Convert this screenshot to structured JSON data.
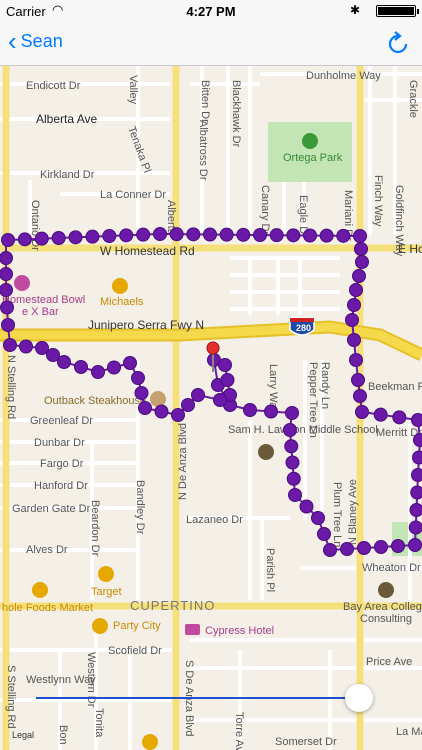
{
  "status_bar": {
    "carrier": "Carrier",
    "time": "4:27 PM"
  },
  "nav": {
    "back_label": "Sean"
  },
  "colors": {
    "accent": "#007aff",
    "route": "#6a1aa6",
    "pin": "#e53030"
  },
  "icons": {
    "back": "chevron-left-icon",
    "refresh": "refresh-icon",
    "wifi": "wifi-icon",
    "bluetooth": "bluetooth-icon"
  },
  "map": {
    "streets": [
      "Endicott Dr",
      "Alberta Ave",
      "Kirkland Dr",
      "La Conner Dr",
      "W Homestead Rd",
      "E Ho",
      "Junipero Serra Fwy N",
      "280",
      "Dunholme Way",
      "Ortega Park",
      "Outback Steakhouse",
      "Greenleaf Dr",
      "Dunbar Dr",
      "Fargo Dr",
      "Hanford Dr",
      "Garden Gate Dr",
      "Alves Dr",
      "Lazaneo Dr",
      "Sam H. Lawson Middle School",
      "N Blaney Ave",
      "N De Anza Blvd",
      "Bandley Dr",
      "Beardon Dr",
      "Tenaka Pl",
      "Bitten Dr",
      "Blackhawk Dr",
      "Albatross Dr",
      "Canary Dr",
      "Eagle Dr",
      "Mariani Dr",
      "Finch Way",
      "Goldfinch Way",
      "Pepper Tree Ln",
      "Randy Ln",
      "Larry Way",
      "Parish Pl",
      "Plum Tree Ln",
      "Merritt Dr",
      "Beekman Pl",
      "Wheaton Dr",
      "Target",
      "Michaels",
      "Homestead Bowl",
      "e X Bar",
      "CUPERTINO",
      "hole Foods Market",
      "Party City",
      "Cypress Hotel",
      "Bay Area College",
      "Consulting",
      "Scofield Dr",
      "Price Ave",
      "Westlynn Way",
      "N Stelling Rd",
      "S Stelling Rd",
      "Somerset Dr",
      "La Mar",
      "Torre Ave",
      "S De Anza Blvd",
      "Valley",
      "Alberta",
      "Tonita",
      "Bon",
      "Ontario Dr",
      "Western Dr",
      "Grackle"
    ],
    "legal": "Legal"
  },
  "timeline": {
    "position": 0.95
  }
}
